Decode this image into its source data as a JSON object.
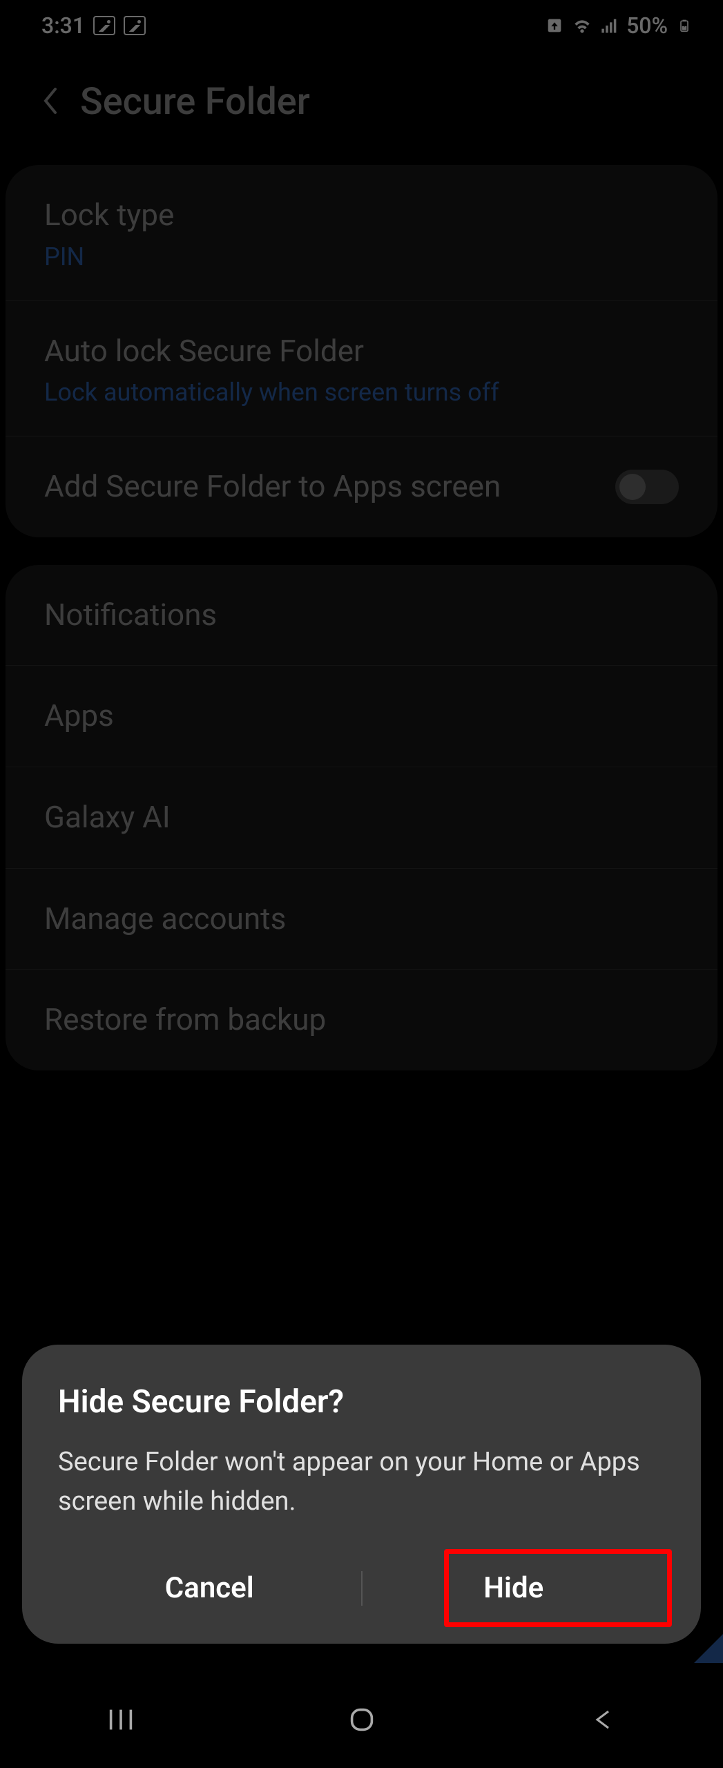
{
  "status": {
    "time": "3:31",
    "battery": "50%"
  },
  "header": {
    "title": "Secure Folder"
  },
  "settings_group1": [
    {
      "title": "Lock type",
      "subtitle": "PIN",
      "toggle": false
    },
    {
      "title": "Auto lock Secure Folder",
      "subtitle": "Lock automatically when screen turns off",
      "toggle": false
    },
    {
      "title": "Add Secure Folder to Apps screen",
      "subtitle": "",
      "toggle": true
    }
  ],
  "settings_group2": [
    {
      "title": "Notifications"
    },
    {
      "title": "Apps"
    },
    {
      "title": "Galaxy AI"
    },
    {
      "title": "Manage accounts"
    },
    {
      "title": "Restore from backup"
    }
  ],
  "dialog": {
    "title": "Hide Secure Folder?",
    "body": "Secure Folder won't appear on your Home or Apps screen while hidden.",
    "cancel": "Cancel",
    "confirm": "Hide"
  }
}
